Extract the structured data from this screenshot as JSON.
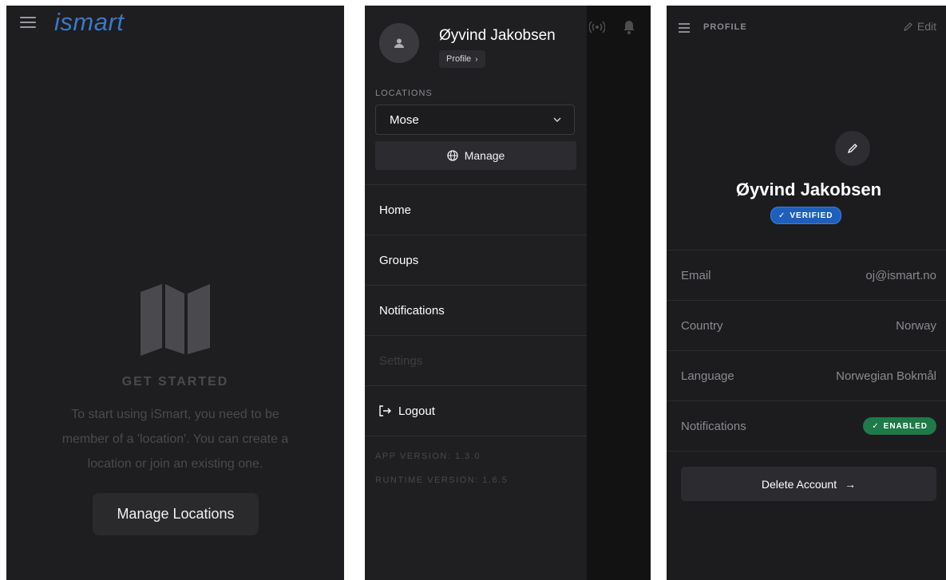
{
  "screen1": {
    "logo": "ismart",
    "menu_icon": "hamburger-icon",
    "empty_icon": "map-icon",
    "title": "GET STARTED",
    "description": "To start using iSmart, you need to be member of a 'location'. You can create a location or join an existing one.",
    "button_label": "Manage Locations"
  },
  "screen2": {
    "user_name": "Øyvind Jakobsen",
    "profile_chip": "Profile",
    "locations_label": "LOCATIONS",
    "selected_location": "Mose",
    "manage_label": "Manage",
    "nav": [
      {
        "label": "Home",
        "enabled": true
      },
      {
        "label": "Groups",
        "enabled": true
      },
      {
        "label": "Notifications",
        "enabled": true
      },
      {
        "label": "Settings",
        "enabled": false
      }
    ],
    "logout_label": "Logout",
    "app_version": "APP VERSION: 1.3.0",
    "runtime_version": "RUNTIME VERSION: 1.6.5"
  },
  "screen3": {
    "header_title": "PROFILE",
    "edit_label": "Edit",
    "user_name": "Øyvind Jakobsen",
    "verified_badge": "VERIFIED",
    "fields": [
      {
        "key": "Email",
        "value": "oj@ismart.no"
      },
      {
        "key": "Country",
        "value": "Norway"
      },
      {
        "key": "Language",
        "value": "Norwegian Bokmål"
      },
      {
        "key": "Notifications",
        "value": "ENABLED"
      }
    ],
    "delete_label": "Delete Account"
  },
  "colors": {
    "background": "#1e1e20",
    "brand": "#3a78c9",
    "verified": "#1e5fbe",
    "enabled": "#1f7a4a"
  }
}
